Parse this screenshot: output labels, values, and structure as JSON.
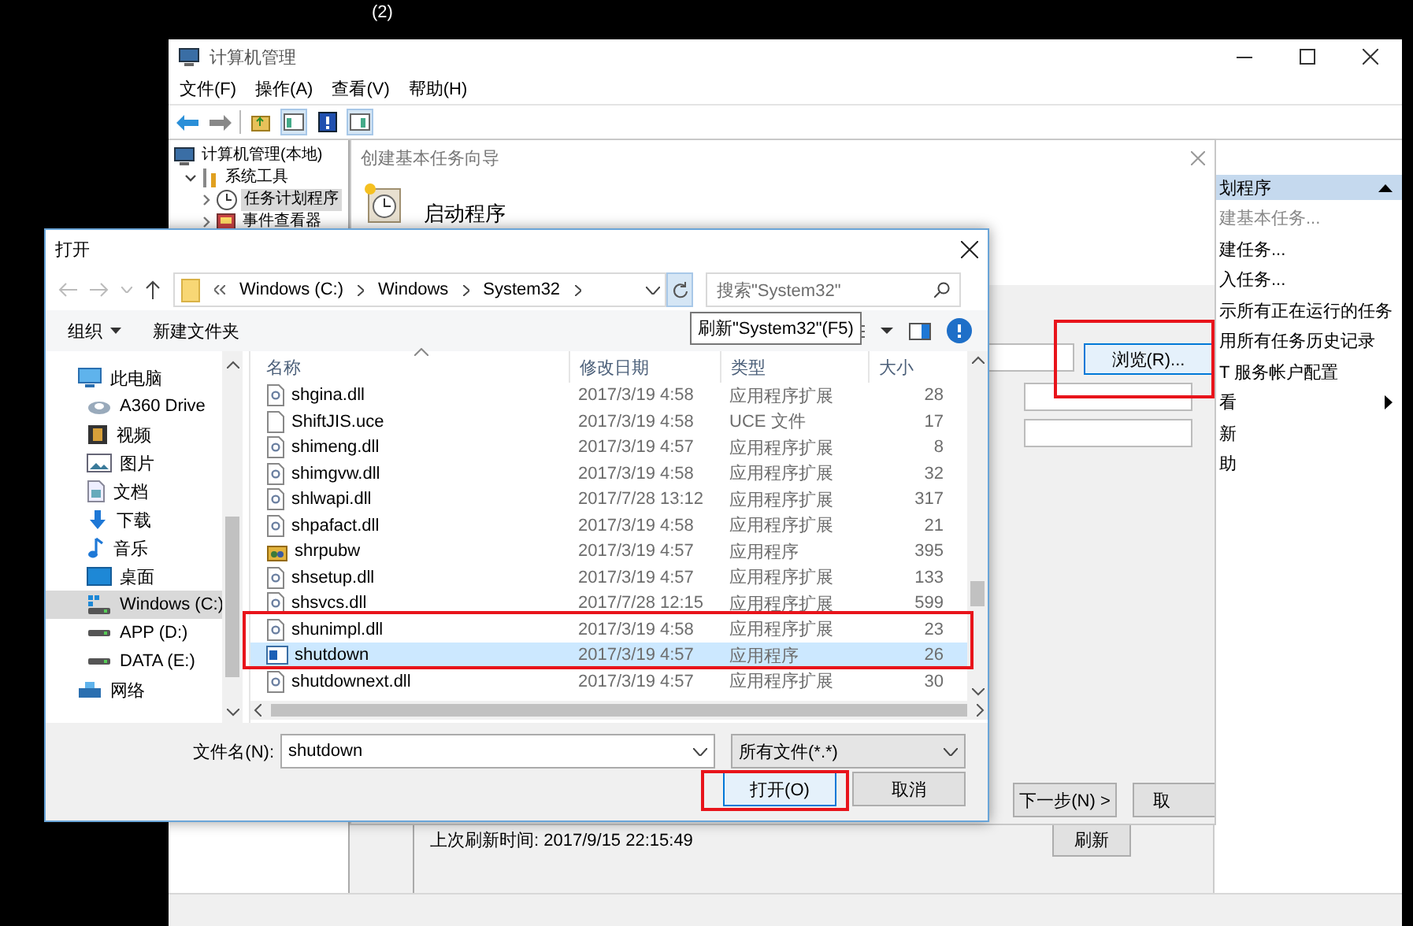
{
  "desktop": {
    "caption": "(2)"
  },
  "computer_management": {
    "title": "计算机管理",
    "menu": [
      "文件(F)",
      "操作(A)",
      "查看(V)",
      "帮助(H)"
    ],
    "tree": [
      {
        "label": "计算机管理(本地)",
        "kind": "computer",
        "selected": false,
        "children": [
          {
            "label": "系统工具",
            "kind": "tools",
            "expanded": true,
            "selected": false,
            "children": [
              {
                "label": "任务计划程序",
                "kind": "clock",
                "expanded": false,
                "selected": true
              },
              {
                "label": "事件查看器",
                "kind": "viewer",
                "expanded": false,
                "selected": false
              }
            ]
          }
        ]
      }
    ],
    "actions": {
      "header": "划程序",
      "items": [
        {
          "label": "建基本任务...",
          "disabled": true,
          "submenu": false
        },
        {
          "label": "建任务...",
          "disabled": false,
          "submenu": false
        },
        {
          "label": "入任务...",
          "disabled": false,
          "submenu": false
        },
        {
          "label": "示所有正在运行的任务",
          "disabled": false,
          "submenu": false
        },
        {
          "label": "用所有任务历史记录",
          "disabled": false,
          "submenu": false
        },
        {
          "label": "T 服务帐户配置",
          "disabled": false,
          "submenu": false
        },
        {
          "label": "看",
          "disabled": false,
          "submenu": true
        },
        {
          "label": "新",
          "disabled": false,
          "submenu": false
        },
        {
          "label": "助",
          "disabled": false,
          "submenu": false
        }
      ]
    },
    "last_refresh": "上次刷新时间: 2017/9/15 22:15:49",
    "refresh_button": "刷新"
  },
  "wizard": {
    "title": "创建基本任务向导",
    "heading": "启动程序",
    "browse_button": "浏览(R)...",
    "buttons": [
      "下一步(N) >",
      "取"
    ]
  },
  "open_dialog": {
    "title": "打开",
    "path": [
      "Windows (C:)",
      "Windows",
      "System32"
    ],
    "search": {
      "placeholder": "搜索\"System32\""
    },
    "organize": "组织",
    "new_folder": "新建文件夹",
    "tooltip": "刷新\"System32\"(F5)",
    "nav": [
      {
        "label": "此电脑",
        "kind": "pc",
        "selected": false
      },
      {
        "label": "A360 Drive",
        "kind": "cloud",
        "selected": false
      },
      {
        "label": "视频",
        "kind": "video",
        "selected": false
      },
      {
        "label": "图片",
        "kind": "picture",
        "selected": false
      },
      {
        "label": "文档",
        "kind": "doc",
        "selected": false
      },
      {
        "label": "下载",
        "kind": "download",
        "selected": false
      },
      {
        "label": "音乐",
        "kind": "music",
        "selected": false
      },
      {
        "label": "桌面",
        "kind": "desktop",
        "selected": false
      },
      {
        "label": "Windows (C:)",
        "kind": "windrive",
        "selected": true
      },
      {
        "label": "APP (D:)",
        "kind": "drive",
        "selected": false
      },
      {
        "label": "DATA (E:)",
        "kind": "drive",
        "selected": false
      },
      {
        "label": "网络",
        "kind": "network",
        "selected": false
      }
    ],
    "columns": [
      "名称",
      "修改日期",
      "类型",
      "大小"
    ],
    "files": [
      {
        "name": "shgina.dll",
        "date": "2017/3/19 4:58",
        "type": "应用程序扩展",
        "size": "28",
        "kind": "dll",
        "selected": false
      },
      {
        "name": "ShiftJIS.uce",
        "date": "2017/3/19 4:58",
        "type": "UCE 文件",
        "size": "17",
        "kind": "file",
        "selected": false
      },
      {
        "name": "shimeng.dll",
        "date": "2017/3/19 4:57",
        "type": "应用程序扩展",
        "size": "8",
        "kind": "dll",
        "selected": false
      },
      {
        "name": "shimgvw.dll",
        "date": "2017/3/19 4:58",
        "type": "应用程序扩展",
        "size": "32",
        "kind": "dll",
        "selected": false
      },
      {
        "name": "shlwapi.dll",
        "date": "2017/7/28 13:12",
        "type": "应用程序扩展",
        "size": "317",
        "kind": "dll",
        "selected": false
      },
      {
        "name": "shpafact.dll",
        "date": "2017/3/19 4:58",
        "type": "应用程序扩展",
        "size": "21",
        "kind": "dll",
        "selected": false
      },
      {
        "name": "shrpubw",
        "date": "2017/3/19 4:57",
        "type": "应用程序",
        "size": "395",
        "kind": "setup",
        "selected": false
      },
      {
        "name": "shsetup.dll",
        "date": "2017/3/19 4:57",
        "type": "应用程序扩展",
        "size": "133",
        "kind": "dll",
        "selected": false
      },
      {
        "name": "shsvcs.dll",
        "date": "2017/7/28 12:15",
        "type": "应用程序扩展",
        "size": "599",
        "kind": "dll",
        "selected": false
      },
      {
        "name": "shunimpl.dll",
        "date": "2017/3/19 4:58",
        "type": "应用程序扩展",
        "size": "23",
        "kind": "dll",
        "selected": false
      },
      {
        "name": "shutdown",
        "date": "2017/3/19 4:57",
        "type": "应用程序",
        "size": "26",
        "kind": "app",
        "selected": true
      },
      {
        "name": "shutdownext.dll",
        "date": "2017/3/19 4:57",
        "type": "应用程序扩展",
        "size": "30",
        "kind": "dll",
        "selected": false
      }
    ],
    "file_name": {
      "label": "文件名(N):",
      "value": "shutdown"
    },
    "file_type": "所有文件(*.*)",
    "buttons": [
      "打开(O)",
      "取消"
    ]
  }
}
